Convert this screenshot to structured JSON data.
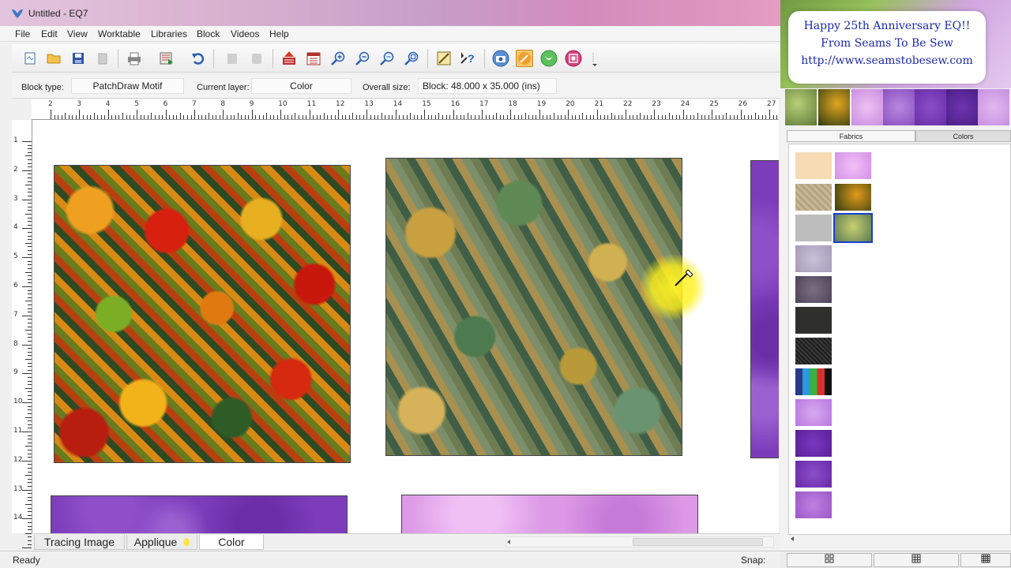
{
  "window": {
    "title": "Untitled - EQ7"
  },
  "menu": [
    "File",
    "Edit",
    "View",
    "Worktable",
    "Libraries",
    "Block",
    "Videos",
    "Help"
  ],
  "info": {
    "block_type_label": "Block type:",
    "block_type_value": "PatchDraw Motif",
    "current_layer_label": "Current layer:",
    "current_layer_value": "Color",
    "overall_size_label": "Overall size:",
    "overall_size_value": "Block: 48.000 x 35.000 (ins)"
  },
  "ruler_h": [
    "2",
    "3",
    "4",
    "5",
    "6",
    "7",
    "8",
    "9",
    "10",
    "11",
    "12",
    "13",
    "14",
    "15",
    "16",
    "17",
    "18",
    "19",
    "20",
    "21",
    "22",
    "23",
    "24",
    "25",
    "26",
    "27"
  ],
  "ruler_v": [
    "1",
    "2",
    "3",
    "4",
    "5",
    "6",
    "7",
    "8",
    "9",
    "10",
    "11",
    "12",
    "13",
    "14"
  ],
  "bottom_tabs": [
    "Tracing Image",
    "Applique",
    "Color"
  ],
  "status": {
    "text": "Ready",
    "snap_label": "Snap:"
  },
  "banner": {
    "line1": "Happy 25th Anniversary EQ!!",
    "line2": "From Seams To Be Sew",
    "line3": "http://www.seamstobesew.com"
  },
  "panel_tabs": {
    "fabrics": "Fabrics",
    "colors": "Colors"
  },
  "colors": {
    "banner_text": "#1b2aa8",
    "selection": "#1a3fcf",
    "highlight_spot": "#fff228"
  },
  "icons": [
    "new-file-icon",
    "open-folder-icon",
    "save-icon",
    "delete-icon",
    "print-icon",
    "export-icon",
    "undo-icon",
    "copy-icon",
    "paste-icon",
    "add-to-sketchbook-icon",
    "sketchbook-icon",
    "zoom-in-icon",
    "zoom-out-icon",
    "zoom-refresh-icon",
    "fit-to-worktable-icon",
    "edit-block-icon",
    "help-icon",
    "camera-icon",
    "paintbrush-icon",
    "spraycan-icon",
    "swap-all-icon"
  ]
}
